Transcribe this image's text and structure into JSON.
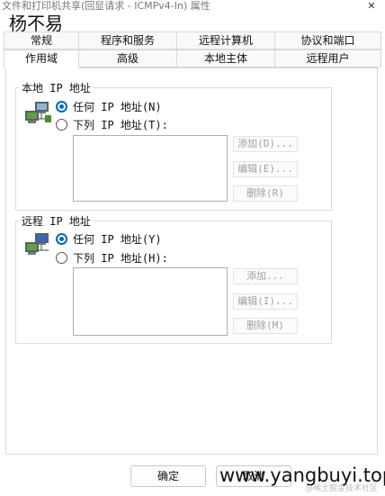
{
  "window": {
    "title": "文件和打印机共享(回显请求 - ICMPv4-In) 属性",
    "close_glyph": "✕"
  },
  "watermarks": {
    "top": "杨不易",
    "bottom": "www.yangbuyi.top",
    "small": "@稀土掘金技术社区"
  },
  "tabs": {
    "row1": [
      "常规",
      "程序和服务",
      "远程计算机",
      "协议和端口"
    ],
    "row2": [
      "作用域",
      "高级",
      "本地主体",
      "远程用户"
    ],
    "active": "作用域"
  },
  "local_ip": {
    "title": "本地 IP 地址",
    "any_label": "任何 IP 地址(N)",
    "these_label": "下列 IP 地址(T):",
    "selected": "any",
    "buttons": {
      "add": "添加(D)...",
      "edit": "编辑(E)...",
      "remove": "删除(R)"
    }
  },
  "remote_ip": {
    "title": "远程 IP 地址",
    "any_label": "任何 IP 地址(Y)",
    "these_label": "下列 IP 地址(H):",
    "selected": "any",
    "buttons": {
      "add": "添加...",
      "edit": "编辑(I)...",
      "remove": "删除(M)"
    }
  },
  "footer": {
    "ok": "确定",
    "cancel": "取消"
  },
  "colors": {
    "accent": "#0067c0",
    "disabled_text": "#a0a0a0"
  },
  "icons": [
    "network-computers-icon",
    "close-icon"
  ]
}
